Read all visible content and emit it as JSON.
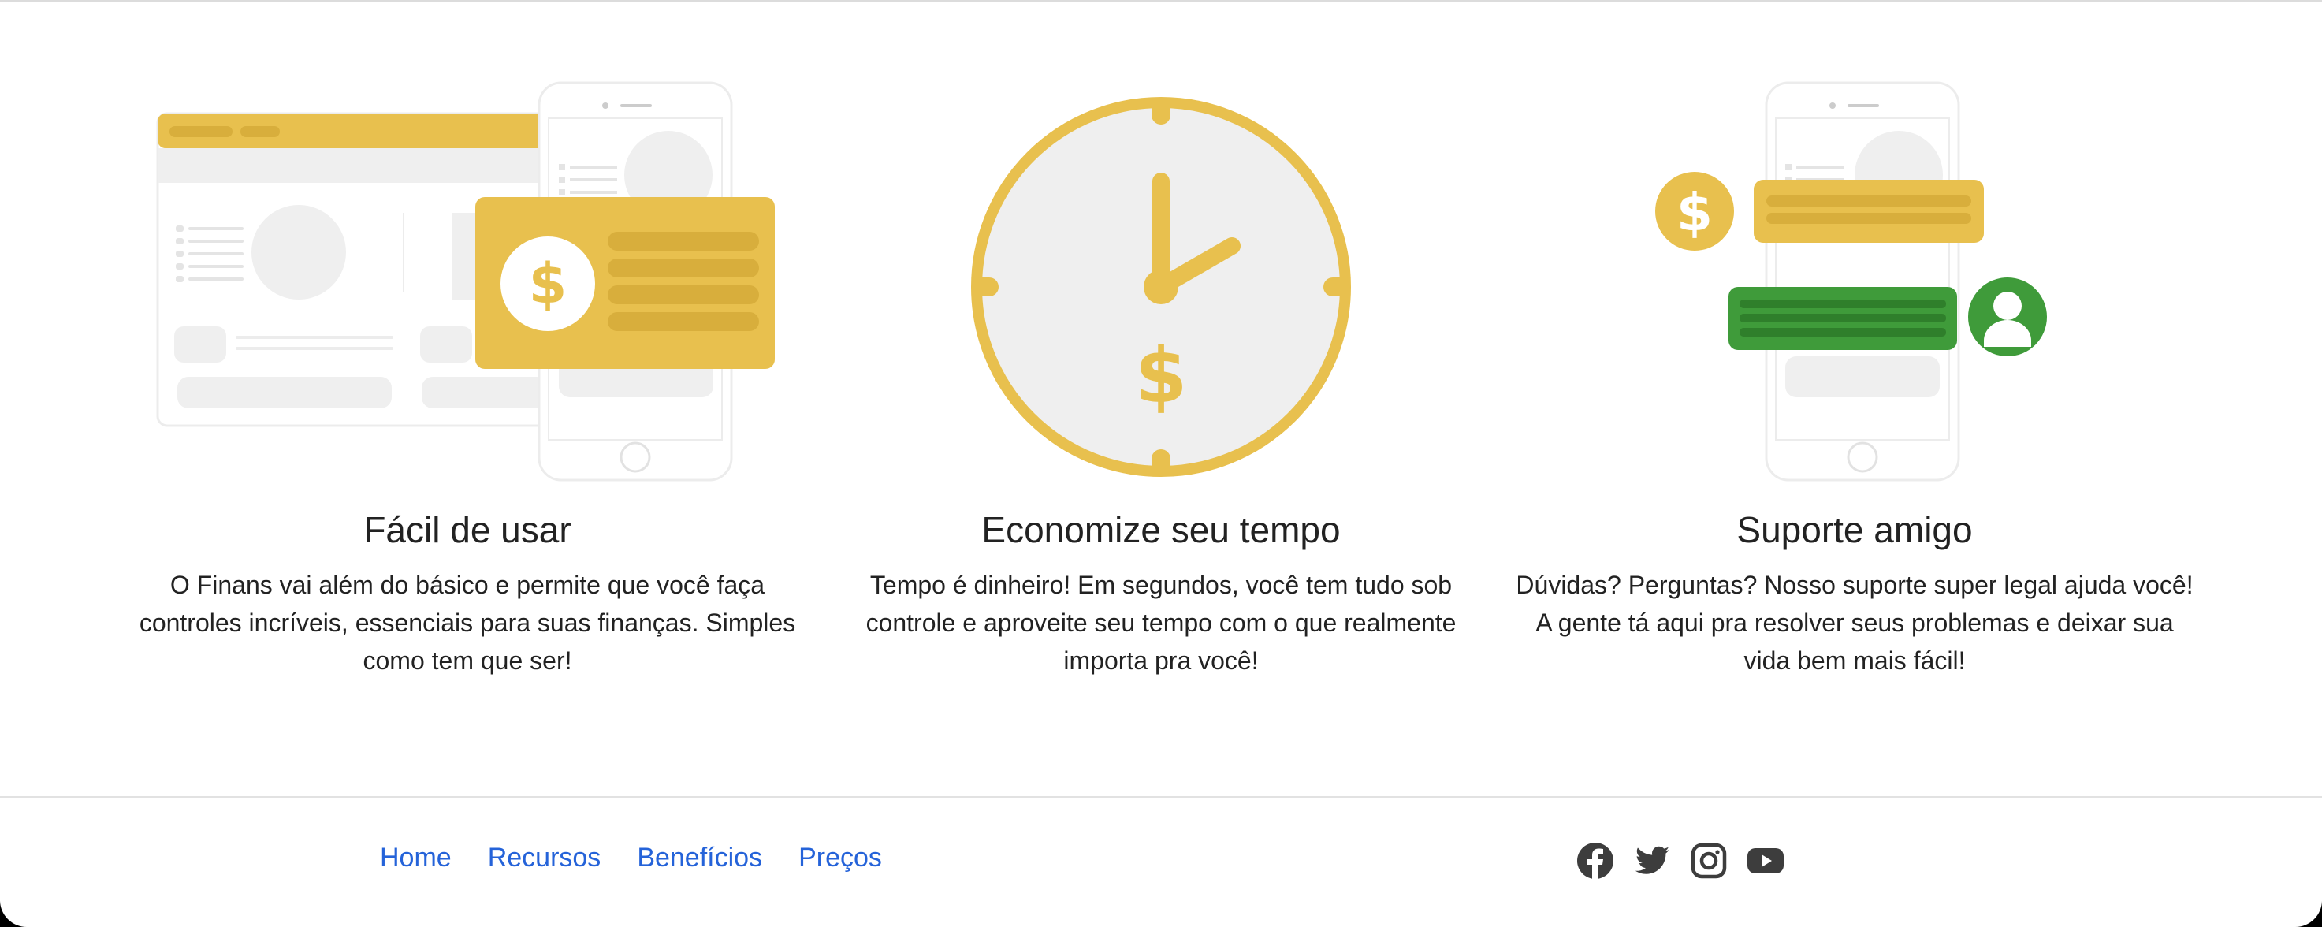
{
  "features": [
    {
      "title": "Fácil de usar",
      "text": "O Finans vai além do básico e permite que você faça controles incríveis, essenciais para suas finanças. Simples como tem que ser!",
      "illustration_icon": "dashboard-phone-illustration"
    },
    {
      "title": "Economize seu tempo",
      "text": "Tempo é dinheiro! Em segundos, você tem tudo sob controle e aproveite seu tempo com o que realmente importa pra você!",
      "illustration_icon": "clock-dollar-illustration"
    },
    {
      "title": "Suporte amigo",
      "text": "Dúvidas? Perguntas? Nosso suporte super legal ajuda você! A gente tá aqui pra resolver seus problemas e deixar sua vida bem mais fácil!",
      "illustration_icon": "chat-support-illustration"
    }
  ],
  "footer": {
    "nav": [
      "Home",
      "Recursos",
      "Benefícios",
      "Preços"
    ],
    "social": [
      "facebook-icon",
      "twitter-icon",
      "instagram-icon",
      "youtube-icon"
    ]
  },
  "colors": {
    "accent_yellow": "#E8C04E",
    "support_green": "#3F9B3A",
    "link_blue": "#2563D9",
    "text_dark": "#222222",
    "light_gray": "#EFEFEF",
    "icon_dark": "#3D3D3D"
  }
}
